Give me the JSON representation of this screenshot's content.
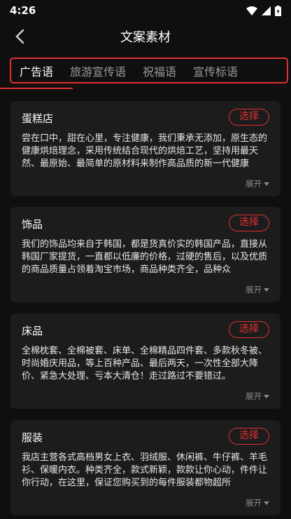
{
  "status_bar": {
    "time": "4:26"
  },
  "header": {
    "title": "文案素材"
  },
  "tabs": [
    {
      "label": "广告语",
      "active": true
    },
    {
      "label": "旅游宣传语",
      "active": false
    },
    {
      "label": "祝福语",
      "active": false
    },
    {
      "label": "宣传标语",
      "active": false
    }
  ],
  "cards": [
    {
      "title": "蛋糕店",
      "button": "选择",
      "text": "尝在口中，甜在心里，专注健康，我们秉承无添加，原生态的健康烘焙理念，采用传统结合现代的烘焙工艺，坚持用最天然、最原始、最简单的原材料来制作高品质的新一代健康",
      "expand": "展开"
    },
    {
      "title": "饰品",
      "button": "选择",
      "text": "我们的饰品均来自于韩国，都是货真价实的韩国产品，直接从韩国厂家提货，一直都以低廉的价格，过硬的售后，以及优质的商品质量占领着淘宝市场，商品种类齐全，品种众",
      "expand": "展开"
    },
    {
      "title": "床品",
      "button": "选择",
      "text": "全棉枕套、全棉被套、床单、全棉精品四件套、多款秋冬被、时尚婚庆用品，等上百种产品、最后两天，一次性全部大降价、紧急大处理、亏本大清仓！走过路过不要错过。",
      "expand": "展开"
    },
    {
      "title": "服装",
      "button": "选择",
      "text": "我店主营各式高档男女上衣、羽绒服、休闲裤、牛仔裤、羊毛衫、保暖内衣。种类齐全，款式新颖，款款让你心动，件件让你行动，在这里，保证您购买到的每件服装都物超所",
      "expand": "展开"
    }
  ]
}
